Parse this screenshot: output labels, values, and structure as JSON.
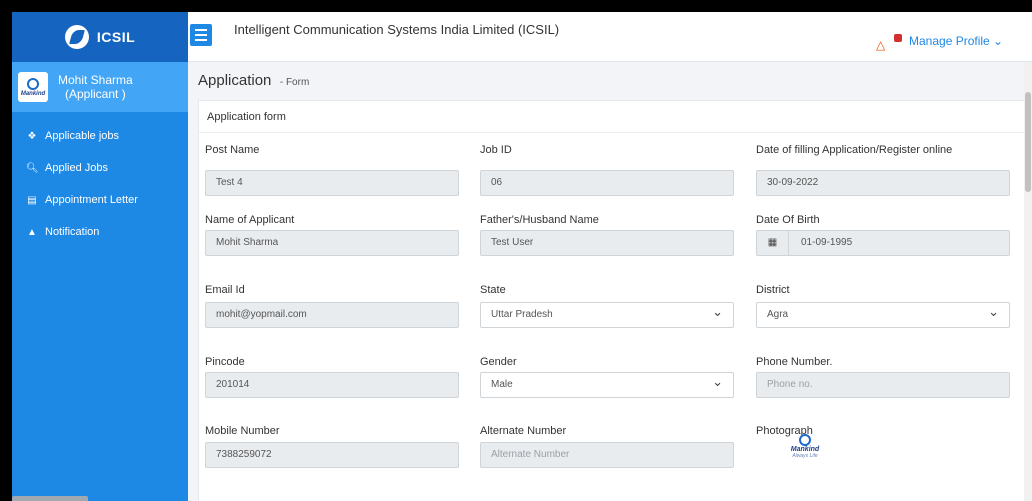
{
  "brand": {
    "name": "ICSIL"
  },
  "user": {
    "name": "Mohit Sharma",
    "role": "(Applicant )",
    "avatar_text": "Mankind"
  },
  "nav": [
    {
      "label": "Applicable jobs",
      "icon": "handshake-icon"
    },
    {
      "label": "Applied Jobs",
      "icon": "search-icon"
    },
    {
      "label": "Appointment Letter",
      "icon": "document-icon"
    },
    {
      "label": "Notification",
      "icon": "bell-icon"
    }
  ],
  "topbar": {
    "title": "Intelligent Communication Systems India Limited (ICSIL)",
    "manage_profile": "Manage Profile ⌄"
  },
  "page": {
    "title": "Application",
    "subtitle": "- Form"
  },
  "form": {
    "header": "Application form",
    "post_name": {
      "label": "Post Name",
      "value": "Test 4"
    },
    "job_id": {
      "label": "Job ID",
      "value": "06"
    },
    "date_filling": {
      "label": "Date of filling Application/Register online",
      "value": "30-09-2022"
    },
    "applicant_name": {
      "label": "Name of Applicant",
      "value": "Mohit Sharma"
    },
    "father_name": {
      "label": "Father's/Husband Name",
      "value": "Test User"
    },
    "dob": {
      "label": "Date Of Birth",
      "value": "01-09-1995"
    },
    "email": {
      "label": "Email Id",
      "value": "mohit@yopmail.com"
    },
    "state": {
      "label": "State",
      "value": "Uttar Pradesh"
    },
    "district": {
      "label": "District",
      "value": "Agra"
    },
    "pincode": {
      "label": "Pincode",
      "value": "201014"
    },
    "gender": {
      "label": "Gender",
      "value": "Male"
    },
    "phone": {
      "label": "Phone Number.",
      "placeholder": "Phone no."
    },
    "mobile": {
      "label": "Mobile Number",
      "value": "7388259072"
    },
    "alternate": {
      "label": "Alternate Number",
      "placeholder": "Alternate Number"
    },
    "photograph": {
      "label": "Photograph",
      "image_text": "Mankind",
      "image_sub": "Always Life"
    }
  },
  "colors": {
    "sidebar": "#1e88e5",
    "brand": "#1565c0",
    "user_panel": "#42a5f5",
    "accent": "#1e88e5"
  }
}
